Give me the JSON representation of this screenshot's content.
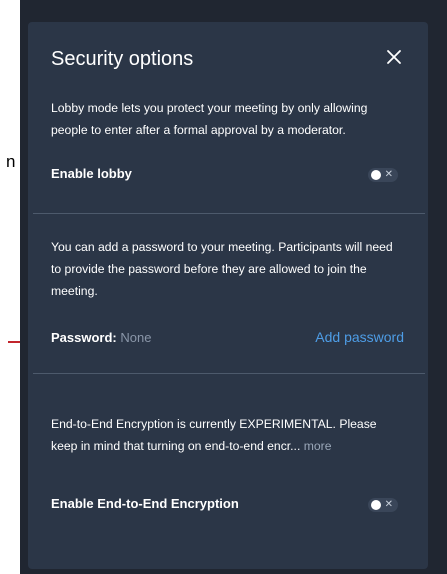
{
  "background_fragment": {
    "text": "n"
  },
  "dialog": {
    "title": "Security options",
    "close_icon": "close-icon"
  },
  "lobby": {
    "description": "Lobby mode lets you protect your meeting by only allowing people to enter after a formal approval by a moderator.",
    "label": "Enable lobby",
    "enabled": false
  },
  "password": {
    "description": "You can add a password to your meeting. Participants will need to provide the password before they are allowed to join the meeting.",
    "label": "Password:",
    "value": "None",
    "add_label": "Add password"
  },
  "e2ee": {
    "description": "End-to-End Encryption is currently EXPERIMENTAL. Please keep in mind that turning on end-to-end encr...",
    "more_label": "more",
    "label": "Enable End-to-End Encryption",
    "enabled": false
  },
  "colors": {
    "dialog_bg": "#2b3647",
    "backdrop": "#202631",
    "link": "#4e9de6",
    "accent_line": "#c2252c"
  }
}
